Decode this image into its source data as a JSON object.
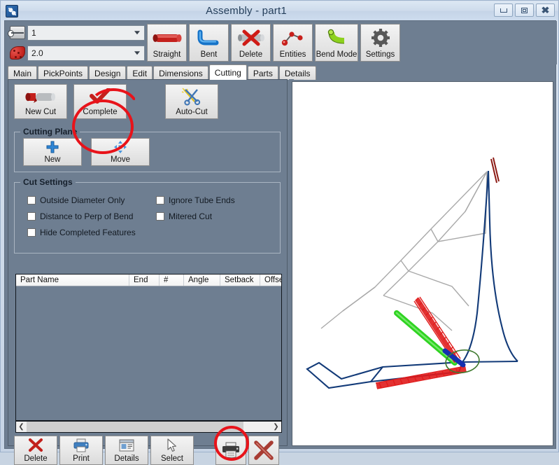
{
  "window": {
    "title": "Assembly - part1",
    "app_icon": "app-logo-icon",
    "controls": {
      "minimize": "minimize-icon",
      "restore": "restore-icon",
      "close": "close-icon"
    }
  },
  "toolbar": {
    "combos": [
      {
        "icon": "tube-caliper-icon",
        "value": "1"
      },
      {
        "icon": "red-wedge-icon",
        "value": "2.0"
      }
    ],
    "buttons": [
      {
        "label": "Straight",
        "icon": "straight-tube-icon"
      },
      {
        "label": "Bent",
        "icon": "bent-tube-icon"
      },
      {
        "label": "Delete",
        "icon": "delete-tube-x-icon"
      },
      {
        "label": "Entities",
        "icon": "entities-nodes-icon"
      },
      {
        "label": "Bend Mode",
        "icon": "bend-mode-icon"
      },
      {
        "label": "Settings",
        "icon": "gear-icon"
      }
    ]
  },
  "tabs": [
    {
      "label": "Main",
      "active": false
    },
    {
      "label": "PickPoints",
      "active": false
    },
    {
      "label": "Design",
      "active": false
    },
    {
      "label": "Edit",
      "active": false
    },
    {
      "label": "Dimensions",
      "active": false
    },
    {
      "label": "Cutting",
      "active": true
    },
    {
      "label": "Parts",
      "active": false
    },
    {
      "label": "Details",
      "active": false
    }
  ],
  "cutting_tab": {
    "actions": [
      {
        "label": "New Cut",
        "icon": "cut-tube-icon"
      },
      {
        "label": "Complete",
        "icon": "red-checkmark-icon"
      },
      {
        "label": "Auto-Cut",
        "icon": "magic-scissors-icon"
      }
    ],
    "cutting_plane": {
      "title": "Cutting Plane",
      "buttons": [
        {
          "label": "New",
          "icon": "blue-plus-icon"
        },
        {
          "label": "Move",
          "icon": "move-arrows-icon"
        }
      ]
    },
    "cut_settings": {
      "title": "Cut Settings",
      "checkboxes": [
        {
          "label": "Outside Diameter Only",
          "checked": false
        },
        {
          "label": "Distance to Perp of Bend",
          "checked": false
        },
        {
          "label": "Hide Completed Features",
          "checked": false
        },
        {
          "label": "Ignore Tube Ends",
          "checked": false
        },
        {
          "label": "Mitered Cut",
          "checked": false
        }
      ]
    },
    "table": {
      "columns": [
        "Part Name",
        "End",
        "#",
        "Angle",
        "Setback",
        "Offset"
      ],
      "rows": []
    },
    "scrollbar": {
      "left_arrow": "chevron-left-icon",
      "right_arrow": "chevron-right-icon"
    },
    "bottom_buttons": [
      {
        "label": "Delete",
        "icon": "red-x-icon"
      },
      {
        "label": "Print",
        "icon": "printer-icon"
      },
      {
        "label": "Details",
        "icon": "details-window-icon"
      },
      {
        "label": "Select",
        "icon": "cursor-arrow-icon"
      },
      {
        "label": "",
        "icon": "printer-dark-icon"
      },
      {
        "label": "",
        "icon": "big-red-x-icon"
      }
    ]
  },
  "viewport": {
    "name": "3d-tube-assembly-viewport",
    "background": "#ffffff",
    "geometry_colors": {
      "wireframe_gray": "#a9a9a9",
      "tube_navy": "#123a78",
      "selected_green": "#2fd321",
      "cut_red": "#e01b1b",
      "highlight_ring": "#3f7a2f"
    }
  },
  "annotations": {
    "accent_color": "#e8131a",
    "marks": [
      {
        "name": "complete-button-highlight",
        "shape": "ellipse"
      },
      {
        "name": "print-button-highlight",
        "shape": "ellipse"
      },
      {
        "name": "design-tab-strikethrough",
        "shape": "arc"
      }
    ]
  }
}
